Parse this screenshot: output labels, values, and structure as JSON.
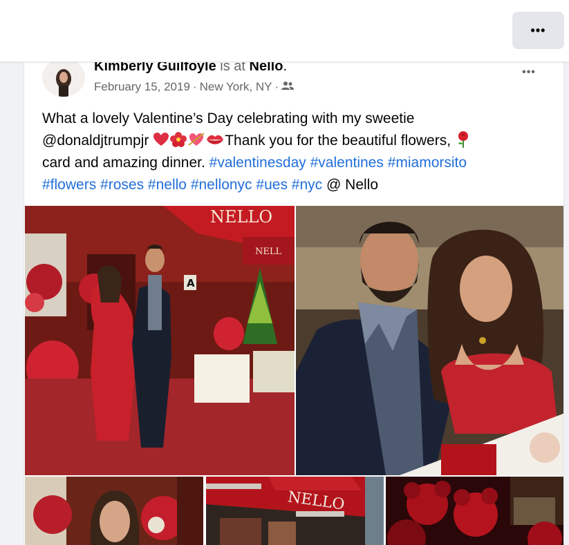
{
  "topbar": {
    "more_label": "•••"
  },
  "post": {
    "author": "Kimberly Guilfoyle",
    "is_at": "is at",
    "place": "Nello",
    "place_suffix": ".",
    "date": "February 15, 2019",
    "sep1": "·",
    "location": "New York, NY",
    "sep2": "·",
    "audience_icon": "friends-icon",
    "more_label": "•••",
    "text": {
      "line1": "What a lovely Valentine’s Day celebrating with my sweetie",
      "line2_a": "@donaldjtrumpjr ",
      "line2_emoji": [
        "red-heart",
        "hibiscus",
        "heart-with-arrow",
        "kiss-mark"
      ],
      "line2_b": "Thank you for the beautiful flowers, ",
      "line2_emoji2": "rose",
      "line3_a": "card and amazing dinner. ",
      "tags_line3": [
        "#valentinesday",
        "#valentines",
        "#miamorsito"
      ],
      "tags_line4": [
        "#flowers",
        "#roses",
        "#nello",
        "#nellonyc",
        "#ues",
        "#nyc"
      ],
      "at_place": " @ Nello"
    },
    "photos": {
      "p1_sign": "NELLO",
      "p1_sign2": "NELL",
      "p1_letter": "A",
      "p4_sign": "NELLO"
    }
  },
  "colors": {
    "link": "#216fdb",
    "muted": "#65676b",
    "awning_red": "#b3141c"
  }
}
